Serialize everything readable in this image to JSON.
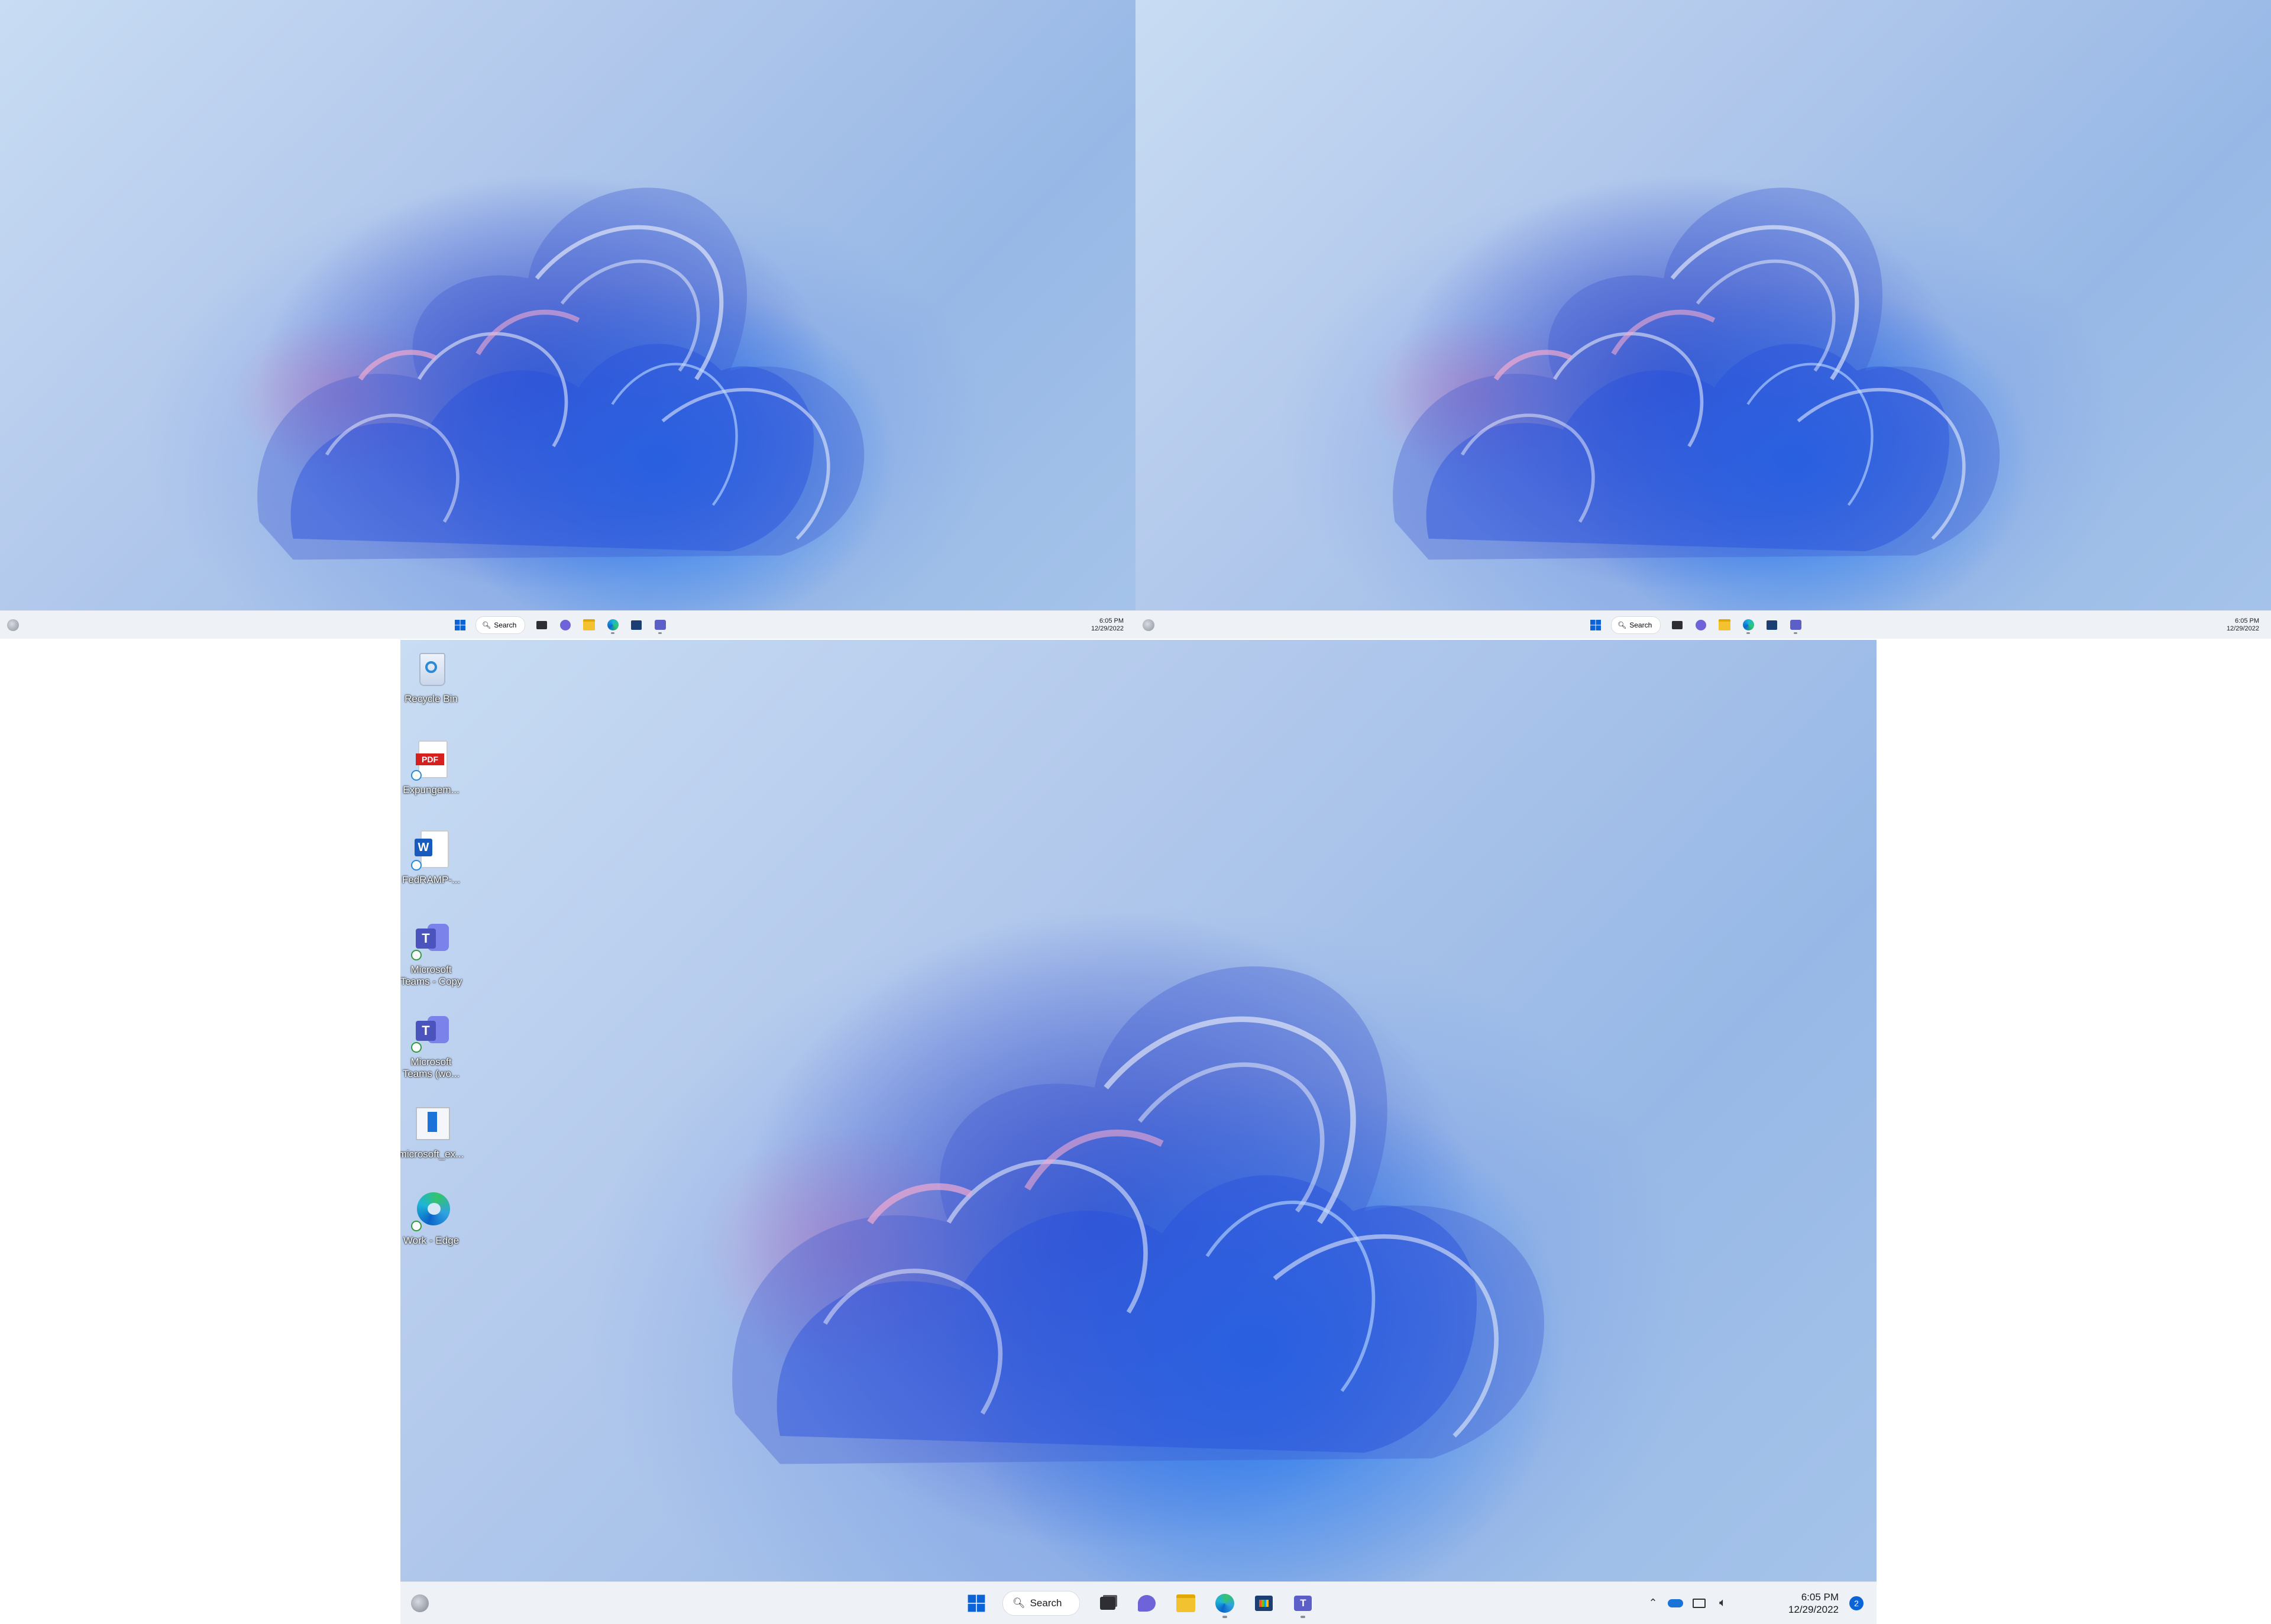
{
  "monitors": {
    "top_left": {
      "taskbar": {
        "search_label": "Search",
        "time": "6:05 PM",
        "date": "12/29/2022"
      }
    },
    "top_right": {
      "taskbar": {
        "search_label": "Search",
        "time": "6:05 PM",
        "date": "12/29/2022"
      }
    },
    "main": {
      "desktop_icons": [
        {
          "label": "Recycle Bin",
          "icon": "recycle-bin-icon"
        },
        {
          "label": "Expungem...",
          "icon": "pdf-file-icon"
        },
        {
          "label": "FedRAMP-...",
          "icon": "word-file-icon"
        },
        {
          "label": "Microsoft Teams - Copy",
          "icon": "teams-icon"
        },
        {
          "label": "Microsoft Teams (wo...",
          "icon": "teams-icon"
        },
        {
          "label": "microsoft_ex...",
          "icon": "document-icon"
        },
        {
          "label": "Work - Edge",
          "icon": "edge-icon"
        }
      ],
      "taskbar": {
        "search_label": "Search",
        "time": "6:05 PM",
        "date": "12/29/2022",
        "notification_count": "2",
        "pinned": [
          "start-icon",
          "search",
          "file-manager-icon",
          "chat-icon",
          "file-explorer-icon",
          "edge-icon",
          "store-icon",
          "teams-icon"
        ]
      }
    }
  },
  "colors": {
    "taskbar_bg": "#eef1f6",
    "accent_blue": "#0a64d8",
    "teams_purple": "#5b5fc7"
  }
}
